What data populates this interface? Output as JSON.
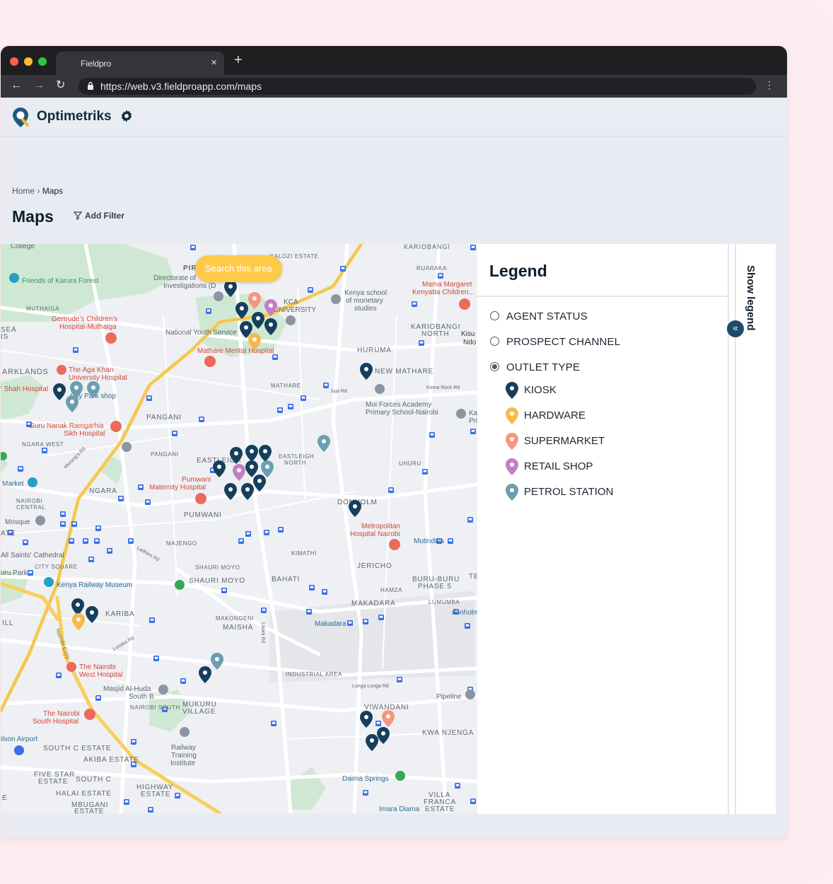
{
  "browser": {
    "tab_title": "Fieldpro",
    "tab_close": "×",
    "new_tab": "+",
    "url": "https://web.v3.fieldproapp.com/maps",
    "back": "←",
    "forward": "→",
    "reload": "↻",
    "menu": "⋮"
  },
  "app": {
    "brand": "Optimetriks"
  },
  "breadcrumb": {
    "home": "Home",
    "sep": "›",
    "current": "Maps"
  },
  "page": {
    "title": "Maps",
    "add_filter": "Add Filter"
  },
  "map": {
    "search_button": "Search this area",
    "labels": {
      "college": "College",
      "pir": "PIR",
      "kalozi": "KALOZI ESTATE",
      "kariobangi_top": "KARIOBANGI",
      "ruaraka": "RUARAKA",
      "karura": "Friends of Karura Forest",
      "directorate1": "Directorate of",
      "directorate2": "Investigations (D",
      "kca1": "KCA",
      "kca2": "UNIVERSITY",
      "kenya_school1": "Kenya school",
      "kenya_school2": "of monetary",
      "kenya_school3": "studies",
      "mama1": "Mama Margaret",
      "mama2": "Kenyatta Children...",
      "muthaiga": "MUTHAIGA",
      "gertrude1": "Gertrude's Children's",
      "gertrude2": "Hospital-Muthaiga",
      "kariobangi_n1": "KARIOBANGI",
      "kariobangi_n2": "NORTH",
      "kisu": "Kisu",
      "ndo": "Ndo",
      "sea": "SEA",
      "is": "IS",
      "nys": "National Youth Service",
      "mathare_hosp": "Mathare Mental Hospital",
      "huruma": "HURUMA",
      "parklands": "ARKLANDS",
      "aga1": "The Aga Khan",
      "aga2": "University Hospital",
      "shah": "' Shah Hospital",
      "city_park": "City Park shop",
      "new_mathare": "NEW MATHARE",
      "mathare": "MATHARE",
      "juja1": "Juja Rd",
      "koma": "Koma Rock Rd",
      "moi1": "Moi Forces Academy",
      "moi2": "Primary School-Nairobi",
      "ka": "Ka",
      "pri": "Pri",
      "pangani": "PANGANI",
      "guru1": "Guru Nanak Ramgarhia",
      "guru2": "Sikh Hospital",
      "ngara_west": "NGARA WEST",
      "pangani2": "PANGANI",
      "eastleigh": "EASTLEIGH",
      "eastleigh_n1": "EASTLEIGH",
      "eastleigh_n2": "NORTH",
      "uhuru": "UHURU",
      "market": "Market",
      "ngara": "NGARA",
      "pumwani1": "Pumwani",
      "pumwani2": "Maternity Hospital",
      "pumwani3": "PUMWANI",
      "nbi_c1": "NAIROBI",
      "nbi_c2": "CENTRAL",
      "mosque": "Mosque",
      "ate": "ATE",
      "dondholm": "DONHOLM",
      "metro1": "Metropolitan",
      "metro2": "Hospital Nairobi",
      "mutindwa": "Mutindwa",
      "majengo": "MAJENGO",
      "allsaints": "All Saints' Cathedral",
      "kimathi": "KIMATHI",
      "city_sq": "CITY SQUARE",
      "jericho": "JERICHO",
      "shauri1": "SHAURI MOYO",
      "shauri2": "SHAURI MOYO",
      "bahati": "BAHATI",
      "buru1": "BURU-BURU",
      "buru2": "PHASE 5",
      "uru_park": "uru Park",
      "railway_museum": "Kenya Railway Museum",
      "hamza": "HAMZA",
      "te": "TE",
      "lumumba": "LUMUMBA",
      "makadara": "MAKADARA",
      "donholm2": "donholm",
      "kariba": "KARIBA",
      "makongeni1": "MAKONGENI",
      "makongeni2": "MAISHA",
      "makadara2": "Makadara",
      "ill": "ILL",
      "nbi_west1": "The Nairobi",
      "nbi_west2": "West Hospital",
      "industrial": "INDUSTRIAL AREA",
      "lunga": "Lunga Lunga Rd",
      "masjid1": "Masjid Al-Huda",
      "masjid2": "South B",
      "pipeline": "Pipeline",
      "nbi_south": "NAIROBI SOUTH",
      "mukuru1": "MUKURU",
      "mukuru2": "VILLAGE",
      "viwandani": "VIWANDANI",
      "nsh1": "The Nairobi",
      "nsh2": "South Hospital",
      "kwa_njenga": "KWA NJENGA",
      "wilson": "ilson Airport",
      "south_c": "SOUTH C ESTATE",
      "railway1": "Railway",
      "railway2": "Training",
      "railway3": "Institute",
      "akiba": "AKIBA ESTATE",
      "five_star1": "FIVE STAR",
      "five_star2": "ESTATE",
      "south_c2": "SOUTH C",
      "daima": "Daima Springs",
      "halai": "HALAI ESTATE",
      "highway1": "HIGHWAY",
      "highway2": "ESTATE",
      "villa1": "VILLA",
      "villa2": "FRANCA",
      "villa3": "ESTATE",
      "mbugani1": "MBUGANI",
      "mbugani2": "ESTATE",
      "imara": "Imara Diama",
      "e": "E",
      "nbi_expy": "Nairobi Expy",
      "lusaka": "Lusaka Rd",
      "likoni": "Likoni Rd",
      "ladhies": "Ladhies Rd",
      "murang": "Murang'a Rd"
    }
  },
  "legend": {
    "title": "Legend",
    "groups": [
      {
        "label": "AGENT STATUS",
        "selected": false
      },
      {
        "label": "PROSPECT CHANNEL",
        "selected": false
      },
      {
        "label": "OUTLET TYPE",
        "selected": true
      }
    ],
    "items": [
      {
        "label": "KIOSK",
        "color": "#163f5c"
      },
      {
        "label": "HARDWARE",
        "color": "#f9b94a"
      },
      {
        "label": "SUPERMARKET",
        "color": "#f7967e"
      },
      {
        "label": "RETAIL SHOP",
        "color": "#c47fc4"
      },
      {
        "label": "PETROL STATION",
        "color": "#6a9fb0"
      }
    ],
    "show_legend": "Show legend",
    "collapse_icon": "«"
  }
}
